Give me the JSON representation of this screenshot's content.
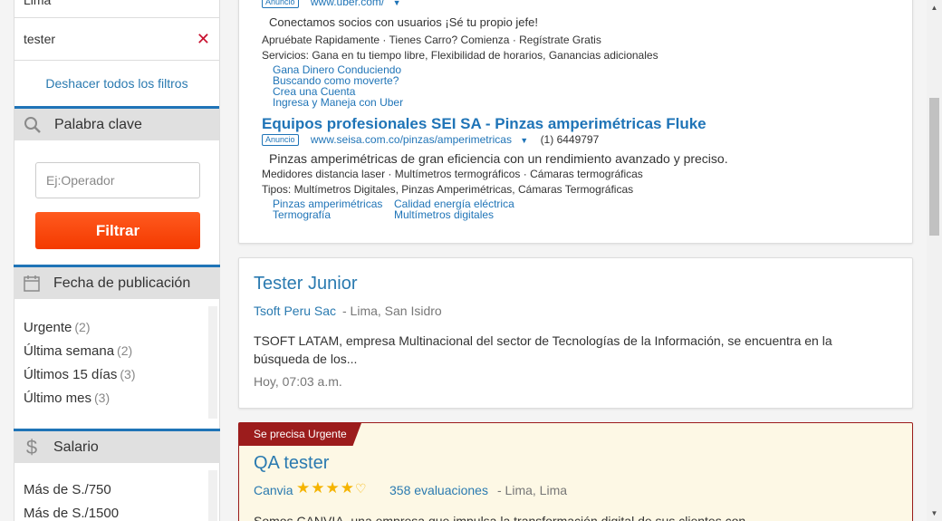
{
  "sidebar": {
    "location_value": "Lima",
    "active_filter": "tester",
    "undo_filters": "Deshacer todos los filtros",
    "keyword": {
      "title": "Palabra clave",
      "placeholder": "Ej:Operador",
      "button": "Filtrar"
    },
    "date": {
      "title": "Fecha de publicación",
      "options": [
        {
          "label": "Urgente",
          "count": "(2)"
        },
        {
          "label": "Última semana",
          "count": "(2)"
        },
        {
          "label": "Últimos 15 días",
          "count": "(3)"
        },
        {
          "label": "Último mes",
          "count": "(3)"
        }
      ]
    },
    "salary": {
      "title": "Salario",
      "options": [
        {
          "label": "Más de S./750"
        },
        {
          "label": "Más de S./1500"
        }
      ]
    }
  },
  "ads": {
    "uber": {
      "badge": "Anuncio",
      "url": "www.uber.com/",
      "desc": "Conectamos socios con usuarios ¡Sé tu propio jefe!",
      "line1": "Apruébate Rapidamente · Tienes Carro? Comienza · Regístrate Gratis",
      "line2": "Servicios: Gana en tu tiempo libre, Flexibilidad de horarios, Ganancias adicionales",
      "sitelinks": [
        "Gana Dinero Conduciendo",
        "Buscando como moverte?",
        "Crea una Cuenta",
        "Ingresa y Maneja con Uber"
      ]
    },
    "sei": {
      "title": "Equipos profesionales SEI SA - Pinzas amperimétricas Fluke",
      "badge": "Anuncio",
      "url": "www.seisa.com.co/pinzas/amperimetricas",
      "phone": "(1) 6449797",
      "desc": "Pinzas amperimétricas de gran eficiencia con un rendimiento avanzado y preciso.",
      "line1": "Medidores distancia laser · Multímetros termográficos · Cámaras termográficas",
      "line2": "Tipos: Multímetros Digitales, Pinzas Amperimétricas, Cámaras Termográficas",
      "sitelinks_col1": [
        "Pinzas amperimétricas",
        "Termografía"
      ],
      "sitelinks_col2": [
        "Calidad energía eléctrica",
        "Multímetros digitales"
      ]
    }
  },
  "jobs": [
    {
      "title": "Tester Junior",
      "company": "Tsoft Peru Sac",
      "location": "- Lima, San Isidro",
      "description": "TSOFT LATAM, empresa Multinacional del sector de Tecnologías de la Información, se encuentra en la búsqueda de los...",
      "date": "Hoy, 07:03 a.m."
    },
    {
      "badge": "Se precisa Urgente",
      "title": "QA tester",
      "company": "Canvia",
      "rating": 4,
      "rating_max": 5,
      "reviews": "358 evaluaciones",
      "location": "- Lima, Lima",
      "description": "Somos CANVIA, una empresa que impulsa la transformación digital de sus clientes con..."
    }
  ],
  "colors": {
    "accent_blue": "#1f74b7",
    "filter_button": "#f43a00",
    "urgent_red": "#9c1c1c",
    "star": "#f5b400"
  }
}
